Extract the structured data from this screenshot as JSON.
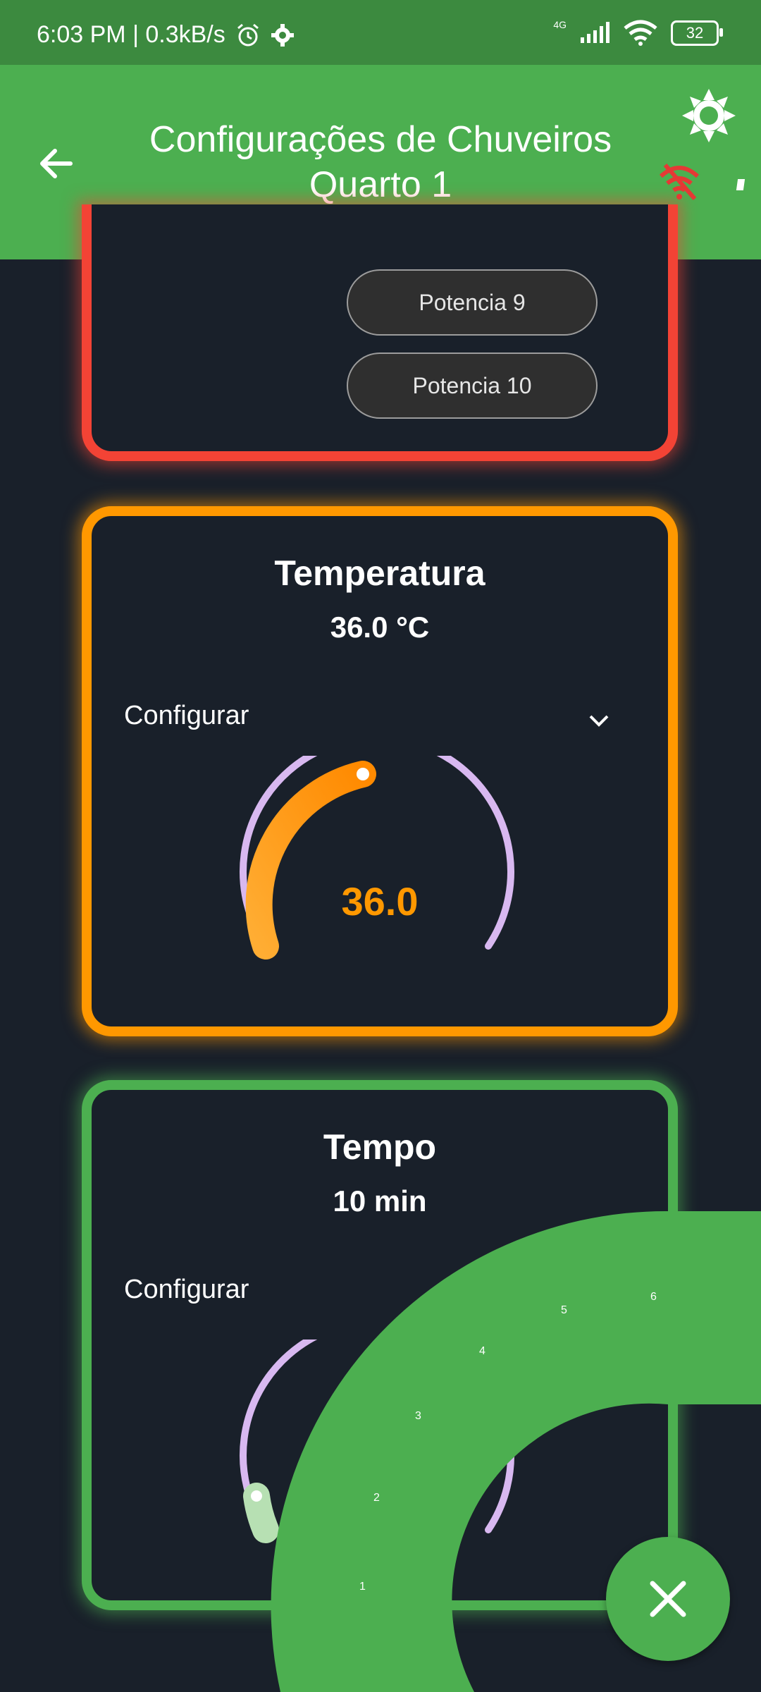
{
  "status_bar": {
    "time_speed": "6:03 PM | 0.3kB/s",
    "network": "4G",
    "battery": "32"
  },
  "app_bar": {
    "title_line1": "Configurações de Chuveiros",
    "title_line2": "Quarto 1"
  },
  "power_card": {
    "buttons": [
      "Potencia 9",
      "Potencia 10"
    ]
  },
  "temperature_card": {
    "title": "Temperatura",
    "value": "36.0 °C",
    "configure_label": "Configurar",
    "gauge_value": "36.0",
    "gauge_fraction": 0.33
  },
  "time_card": {
    "title": "Tempo",
    "value": "10 min",
    "configure_label": "Configurar",
    "gauge_fraction": 0.03
  },
  "radial_menu": {
    "items": [
      "1",
      "2",
      "3",
      "4",
      "5",
      "6"
    ]
  },
  "colors": {
    "status_bar": "#3c8a3f",
    "app_bar": "#4caf50",
    "background": "#19202a",
    "red_card": "#f34335",
    "orange_card": "#ff9800",
    "green_card": "#4caf50",
    "gauge_track": "#d8b8f0"
  },
  "icons": [
    "back-arrow-icon",
    "sun-settings-icon",
    "wifi-off-icon",
    "alarm-icon",
    "gear-icon",
    "chevron-down-icon",
    "close-icon"
  ]
}
